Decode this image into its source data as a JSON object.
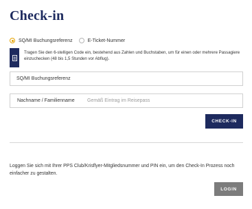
{
  "page": {
    "title": "Check-in"
  },
  "lookup": {
    "options": [
      {
        "label": "SQ/MI Buchungsreferenz",
        "selected": true
      },
      {
        "label": "E-Ticket-Nummer",
        "selected": false
      }
    ],
    "info_icon": "document-icon",
    "info_text": "Tragen Sie den 6-stelligen Code ein, bestehend aus Zahlen und Buchstaben, um für einen oder mehrere Passagiere einzuchecken (48 bis 1,5 Stunden vor Abflug).",
    "booking_field_label": "SQ/MI Buchungsreferenz",
    "name_field_label": "Nachname / Familienname",
    "name_field_placeholder": "Gemäß Eintrag im Reisepass",
    "checkin_button": "CHECK-IN"
  },
  "login": {
    "text": "Loggen Sie sich mit Ihrer PPS Club/Krisflyer-Mitgliedsnummer und PIN ein, um den Check-In Prozess noch einfacher zu gestalten.",
    "button": "LOGIN"
  },
  "colors": {
    "navy": "#1d2a5e",
    "radio_accent": "#e5a200",
    "login_button": "#7c7c7c"
  }
}
